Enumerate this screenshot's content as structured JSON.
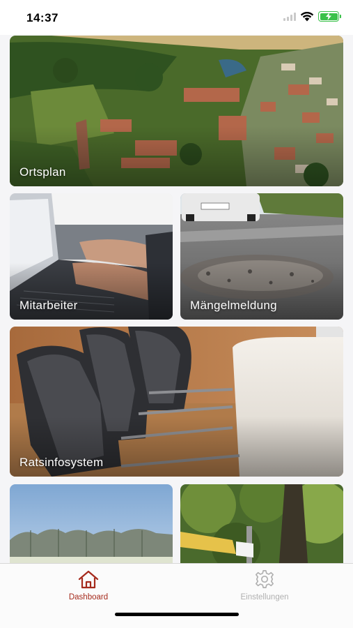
{
  "status_bar": {
    "time": "14:37",
    "icons": [
      "signal-icon",
      "wifi-icon",
      "battery-charging-icon"
    ],
    "battery_color": "#3bc14a"
  },
  "tiles": {
    "ortsplan": "Ortsplan",
    "mitarbeiter": "Mitarbeiter",
    "maengelmeldung": "Mängelmeldung",
    "ratsinfosystem": "Ratsinfosystem"
  },
  "tabbar": {
    "accent_color": "#a52a1c",
    "inactive_color": "#b0b0b0",
    "tabs": [
      {
        "label": "Dashboard",
        "icon": "home-icon",
        "active": true
      },
      {
        "label": "Einstellungen",
        "icon": "gear-icon",
        "active": false
      }
    ]
  }
}
